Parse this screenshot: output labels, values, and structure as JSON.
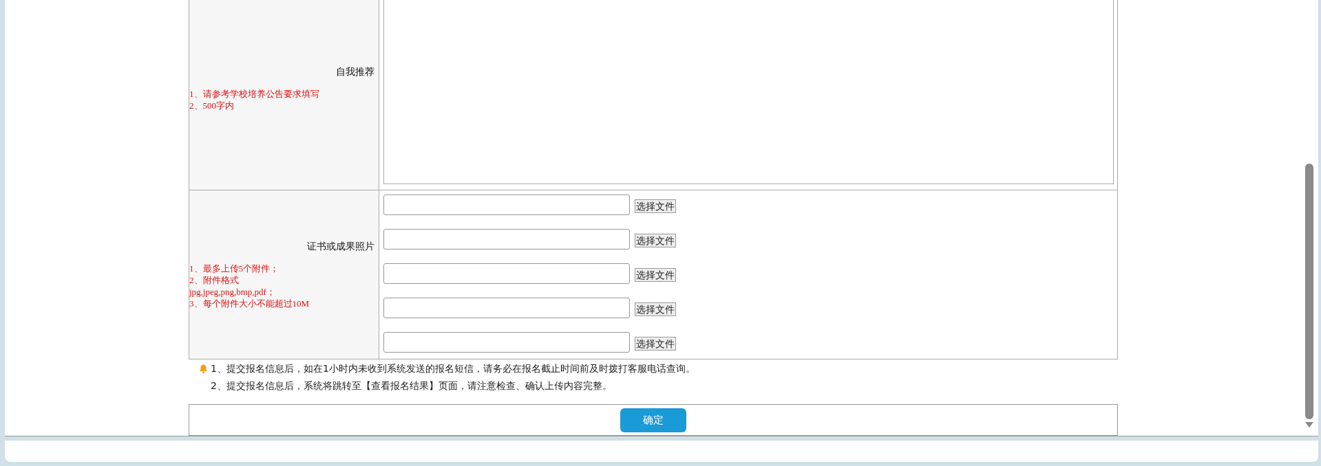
{
  "self_recommendation": {
    "label": "自我推荐",
    "hints": [
      "1、请参考学校培养公告要求填写",
      "2、500字内"
    ]
  },
  "certificates": {
    "label": "证书或成果照片",
    "hints": [
      "1、最多上传5个附件；",
      "2、附件格式",
      "jpg,jpeg,png,bmp,pdf；",
      "3、每个附件大小不能超过10M"
    ],
    "uploads": [
      {
        "button": "选择文件"
      },
      {
        "button": "选择文件"
      },
      {
        "button": "选择文件"
      },
      {
        "button": "选择文件"
      },
      {
        "button": "选择文件"
      }
    ]
  },
  "notices": [
    "1、提交报名信息后，如在1小时内未收到系统发送的报名短信，请务必在报名截止时间前及时拨打客服电话查询。",
    "2、提交报名信息后，系统将跳转至【查看报名结果】页面，请注意检查、确认上传内容完整。"
  ],
  "submit_button": "确定"
}
